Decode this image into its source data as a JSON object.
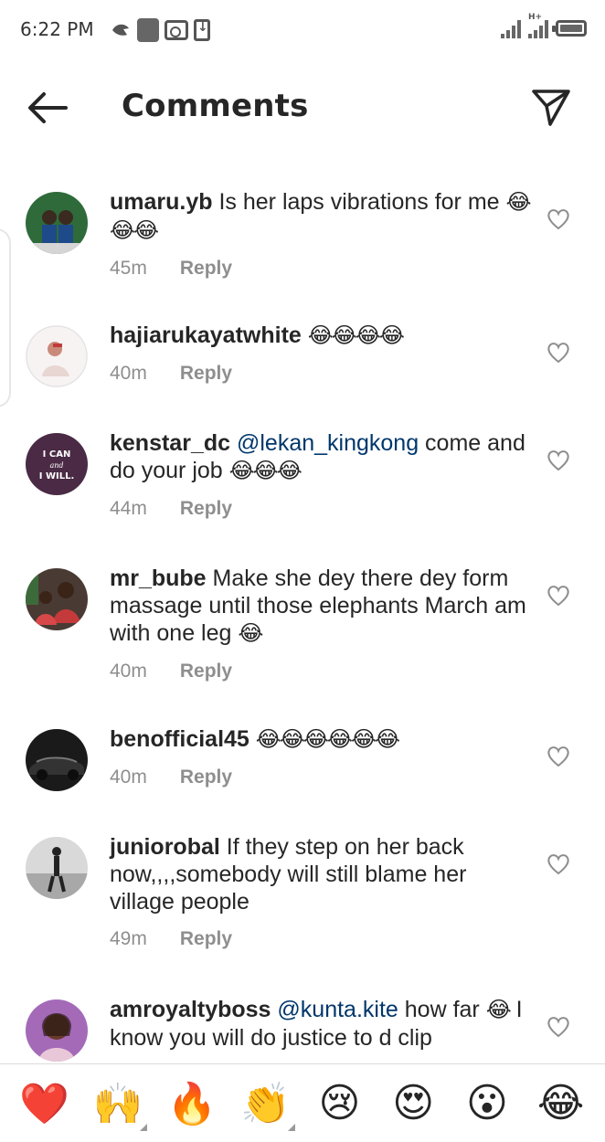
{
  "status_bar": {
    "time": "6:22 PM",
    "network_label": "H+"
  },
  "header": {
    "title": "Comments",
    "back_icon": "back-arrow-icon",
    "share_icon": "send-icon"
  },
  "comments": [
    {
      "username": "umaru.yb",
      "text": " Is her laps vibrations for me ",
      "emoji": "😂😂😂",
      "time": "45m",
      "reply_label": "Reply",
      "avatar_color": "#2f6b3a"
    },
    {
      "username": "hajiarukayatwhite",
      "text": " ",
      "emoji": "😂😂😂😂",
      "time": "40m",
      "reply_label": "Reply",
      "avatar_color": "#e8d6d2"
    },
    {
      "username": "kenstar_dc",
      "mention": "@lekan_kingkong",
      "text": " come and do your job ",
      "emoji": "😂😂😂",
      "time": "44m",
      "reply_label": "Reply",
      "avatar_color": "#4a2a44",
      "avatar_text": [
        "I CAN",
        "and",
        "I WILL."
      ]
    },
    {
      "username": "mr_bube",
      "text": " Make she dey there dey form massage until those elephants March am with one leg ",
      "emoji": "😂",
      "time": "40m",
      "reply_label": "Reply",
      "avatar_color": "#c43a3a"
    },
    {
      "username": "benofficial45",
      "text": " ",
      "emoji": "😂😂😂😂😂😂",
      "time": "40m",
      "reply_label": "Reply",
      "avatar_color": "#1a1a1a"
    },
    {
      "username": "juniorobal",
      "text": " If they step on her back now,,,,somebody will still blame her village people",
      "emoji": "",
      "time": "49m",
      "reply_label": "Reply",
      "avatar_color": "#bfbfbf"
    },
    {
      "username": "amroyaltyboss",
      "mention": "@kunta.kite",
      "text": " how far ",
      "emoji": "😂",
      "text_after": " I know you will do justice to d clip",
      "avatar_color": "#a46ab8"
    }
  ],
  "emoji_bar": [
    {
      "glyph": "❤️",
      "icon": "red-heart-icon"
    },
    {
      "glyph": "🙌",
      "icon": "raising-hands-icon"
    },
    {
      "glyph": "🔥",
      "icon": "fire-icon"
    },
    {
      "glyph": "👏",
      "icon": "clapping-hands-icon"
    },
    {
      "glyph": "😢",
      "icon": "crying-face-icon"
    },
    {
      "glyph": "😍",
      "icon": "heart-eyes-icon"
    },
    {
      "glyph": "😮",
      "icon": "surprised-face-icon"
    },
    {
      "glyph": "😂",
      "icon": "tears-of-joy-icon"
    }
  ]
}
